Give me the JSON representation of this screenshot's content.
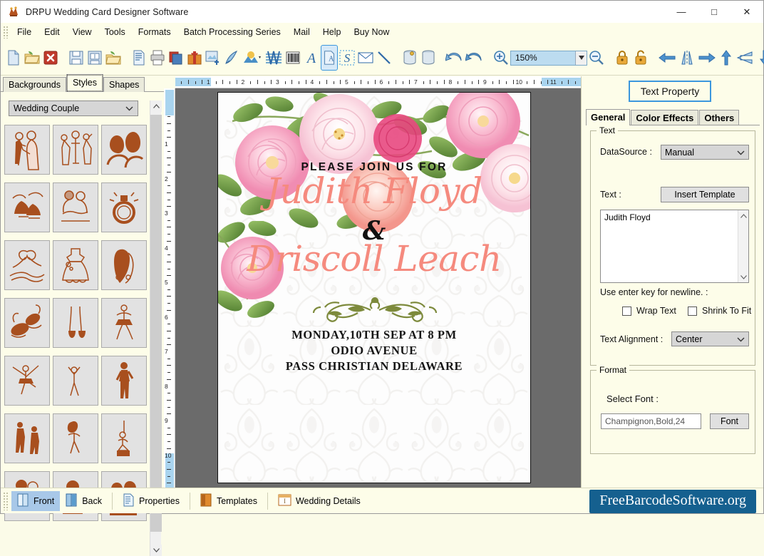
{
  "window": {
    "title": "DRPU Wedding Card Designer Software",
    "icon": "app-icon",
    "minimize": "—",
    "maximize": "□",
    "close": "✕"
  },
  "menubar": {
    "items": [
      {
        "label": "File"
      },
      {
        "label": "Edit"
      },
      {
        "label": "View"
      },
      {
        "label": "Tools"
      },
      {
        "label": "Formats"
      },
      {
        "label": "Batch Processing Series"
      },
      {
        "label": "Mail"
      },
      {
        "label": "Help"
      },
      {
        "label": "Buy Now"
      }
    ]
  },
  "toolbar": {
    "groups": [
      [
        "new-document-icon",
        "open-folder-icon",
        "close-document-icon"
      ],
      [
        "save-icon",
        "save-as-icon",
        "export-folder-icon"
      ],
      [
        "text-document-icon",
        "print-icon",
        "copy-layers-icon",
        "gift-icon",
        "insert-image-icon",
        "pen-icon",
        "picture-shape-icon",
        "watermark-icon",
        "barcode-icon",
        "text-italic-icon",
        "text-frame-icon",
        "signature-icon",
        "envelope-icon",
        "line-icon"
      ],
      [
        "database-settings-icon",
        "database-icon"
      ],
      [
        "undo-icon",
        "redo-icon"
      ]
    ],
    "zoom": {
      "label": "150%",
      "zoom_in": "zoom-in-icon",
      "zoom_out": "zoom-out-icon"
    },
    "locks": [
      "lock-closed-icon",
      "lock-open-icon"
    ],
    "align": [
      "align-left-icon",
      "align-center-vertical-icon",
      "align-right-icon",
      "align-top-icon",
      "align-middle-horizontal-icon",
      "align-bottom-icon"
    ]
  },
  "left_panel": {
    "tabs": [
      {
        "label": "Backgrounds",
        "selected": false
      },
      {
        "label": "Styles",
        "selected": true
      },
      {
        "label": "Shapes",
        "selected": false
      }
    ],
    "category": {
      "value": "Wedding Couple"
    },
    "thumbnails": [
      {
        "name": "bride-groom-dancing"
      },
      {
        "name": "wedding-party"
      },
      {
        "name": "couple-portrait"
      },
      {
        "name": "wedding-bells"
      },
      {
        "name": "couple-hug"
      },
      {
        "name": "engagement-ring"
      },
      {
        "name": "ribbon-bow"
      },
      {
        "name": "bridal-gown"
      },
      {
        "name": "bride-veil"
      },
      {
        "name": "ballet-shoes"
      },
      {
        "name": "pointe-shoes"
      },
      {
        "name": "ballerina-pose"
      },
      {
        "name": "ballerina-arabesque"
      },
      {
        "name": "dancer-stretch"
      },
      {
        "name": "dancer-standing"
      },
      {
        "name": "dancers-pair"
      },
      {
        "name": "dancer-curtsy"
      },
      {
        "name": "dancer-kneeling"
      },
      {
        "name": "couple-embrace"
      },
      {
        "name": "child-dancer"
      },
      {
        "name": "couple-silhouette"
      }
    ]
  },
  "rulers": {
    "horizontal_labels": [
      "1",
      "2",
      "3",
      "4",
      "5",
      "6",
      "7",
      "8",
      "9",
      "10",
      "11"
    ],
    "vertical_labels": [
      "1",
      "2",
      "3",
      "4",
      "5",
      "6",
      "7",
      "8",
      "9",
      "10"
    ]
  },
  "card": {
    "join_line": "PLEASE JOIN US FOR",
    "name1": "Judith Floyd",
    "ampersand": "&",
    "name2": "Driscoll Leach",
    "details": [
      "MONDAY,10TH SEP AT 8 PM",
      "ODIO AVENUE",
      "PASS CHRISTIAN DELAWARE"
    ],
    "colors": {
      "name_color": "#f58a7e",
      "detail_color": "#151515",
      "flourish_color": "#7d8a3c"
    }
  },
  "right_panel": {
    "badge": "Text Property",
    "tabs": [
      {
        "label": "General",
        "selected": true
      },
      {
        "label": "Color Effects",
        "selected": false
      },
      {
        "label": "Others",
        "selected": false
      }
    ],
    "text_group": {
      "legend": "Text",
      "datasource_label": "DataSource :",
      "datasource_value": "Manual",
      "text_label": "Text :",
      "insert_template_button": "Insert Template",
      "textarea_value": "Judith Floyd",
      "hint": "Use enter key for newline. :",
      "wrap_text_label": "Wrap Text",
      "wrap_text_checked": false,
      "shrink_to_fit_label": "Shrink To Fit",
      "shrink_to_fit_checked": false,
      "alignment_label": "Text Alignment :",
      "alignment_value": "Center"
    },
    "format_group": {
      "legend": "Format",
      "select_font_label": "Select Font :",
      "font_value": "Champignon,Bold,24",
      "font_button": "Font"
    }
  },
  "statusbar": {
    "items": [
      {
        "label": "Front",
        "icon": "card-front-icon",
        "selected": true
      },
      {
        "label": "Back",
        "icon": "card-back-icon",
        "selected": false
      },
      {
        "label": "Properties",
        "icon": "properties-icon",
        "selected": false
      },
      {
        "label": "Templates",
        "icon": "templates-icon",
        "selected": false
      },
      {
        "label": "Wedding Details",
        "icon": "wedding-details-icon",
        "selected": false
      }
    ],
    "brand": "FreeBarcodeSoftware.org",
    "brand_color": "#15608f"
  }
}
